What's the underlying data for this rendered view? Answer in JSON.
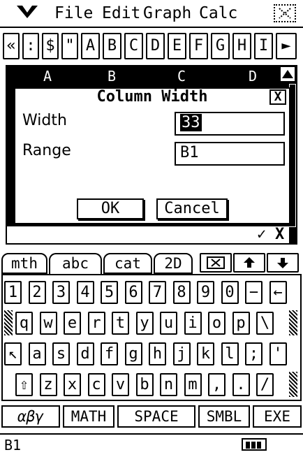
{
  "menubar": {
    "menus": [
      "File",
      "Edit",
      "Graph",
      "Calc"
    ],
    "menu_icon": "triangle-down-icon"
  },
  "toolbar": {
    "buttons": [
      "«",
      ":",
      "$",
      "\"",
      "A",
      "B",
      "C",
      "D",
      "E",
      "F",
      "G",
      "H",
      "I",
      "►"
    ]
  },
  "sheet": {
    "columns": [
      "A",
      "B",
      "C",
      "D"
    ],
    "bottom_buttons": [
      "✓",
      "X"
    ]
  },
  "dialog": {
    "title": "Column Width",
    "width_label": "Width",
    "width_value": "33",
    "range_label": "Range",
    "range_value": "B1",
    "ok_label": "OK",
    "cancel_label": "Cancel"
  },
  "keyboard": {
    "tabs": [
      "mth",
      "abc",
      "cat",
      "2D"
    ],
    "tab_icons": [
      "x-box-icon",
      "up-arrow-icon",
      "down-arrow-icon"
    ],
    "row1": [
      "1",
      "2",
      "3",
      "4",
      "5",
      "6",
      "7",
      "8",
      "9",
      "0",
      "−",
      "←"
    ],
    "row2": [
      "q",
      "w",
      "e",
      "r",
      "t",
      "y",
      "u",
      "i",
      "o",
      "p",
      "\\"
    ],
    "row3": [
      "↖",
      "a",
      "s",
      "d",
      "f",
      "g",
      "h",
      "j",
      "k",
      "l",
      ";",
      "'"
    ],
    "row4": [
      "⇧",
      "z",
      "x",
      "c",
      "v",
      "b",
      "n",
      "m",
      ",",
      ".",
      "/"
    ],
    "function_keys": [
      "αβγ",
      "MATH",
      "SPACE",
      "SMBL",
      "EXE"
    ]
  },
  "status": {
    "cell": "B1",
    "battery": "battery-icon"
  }
}
